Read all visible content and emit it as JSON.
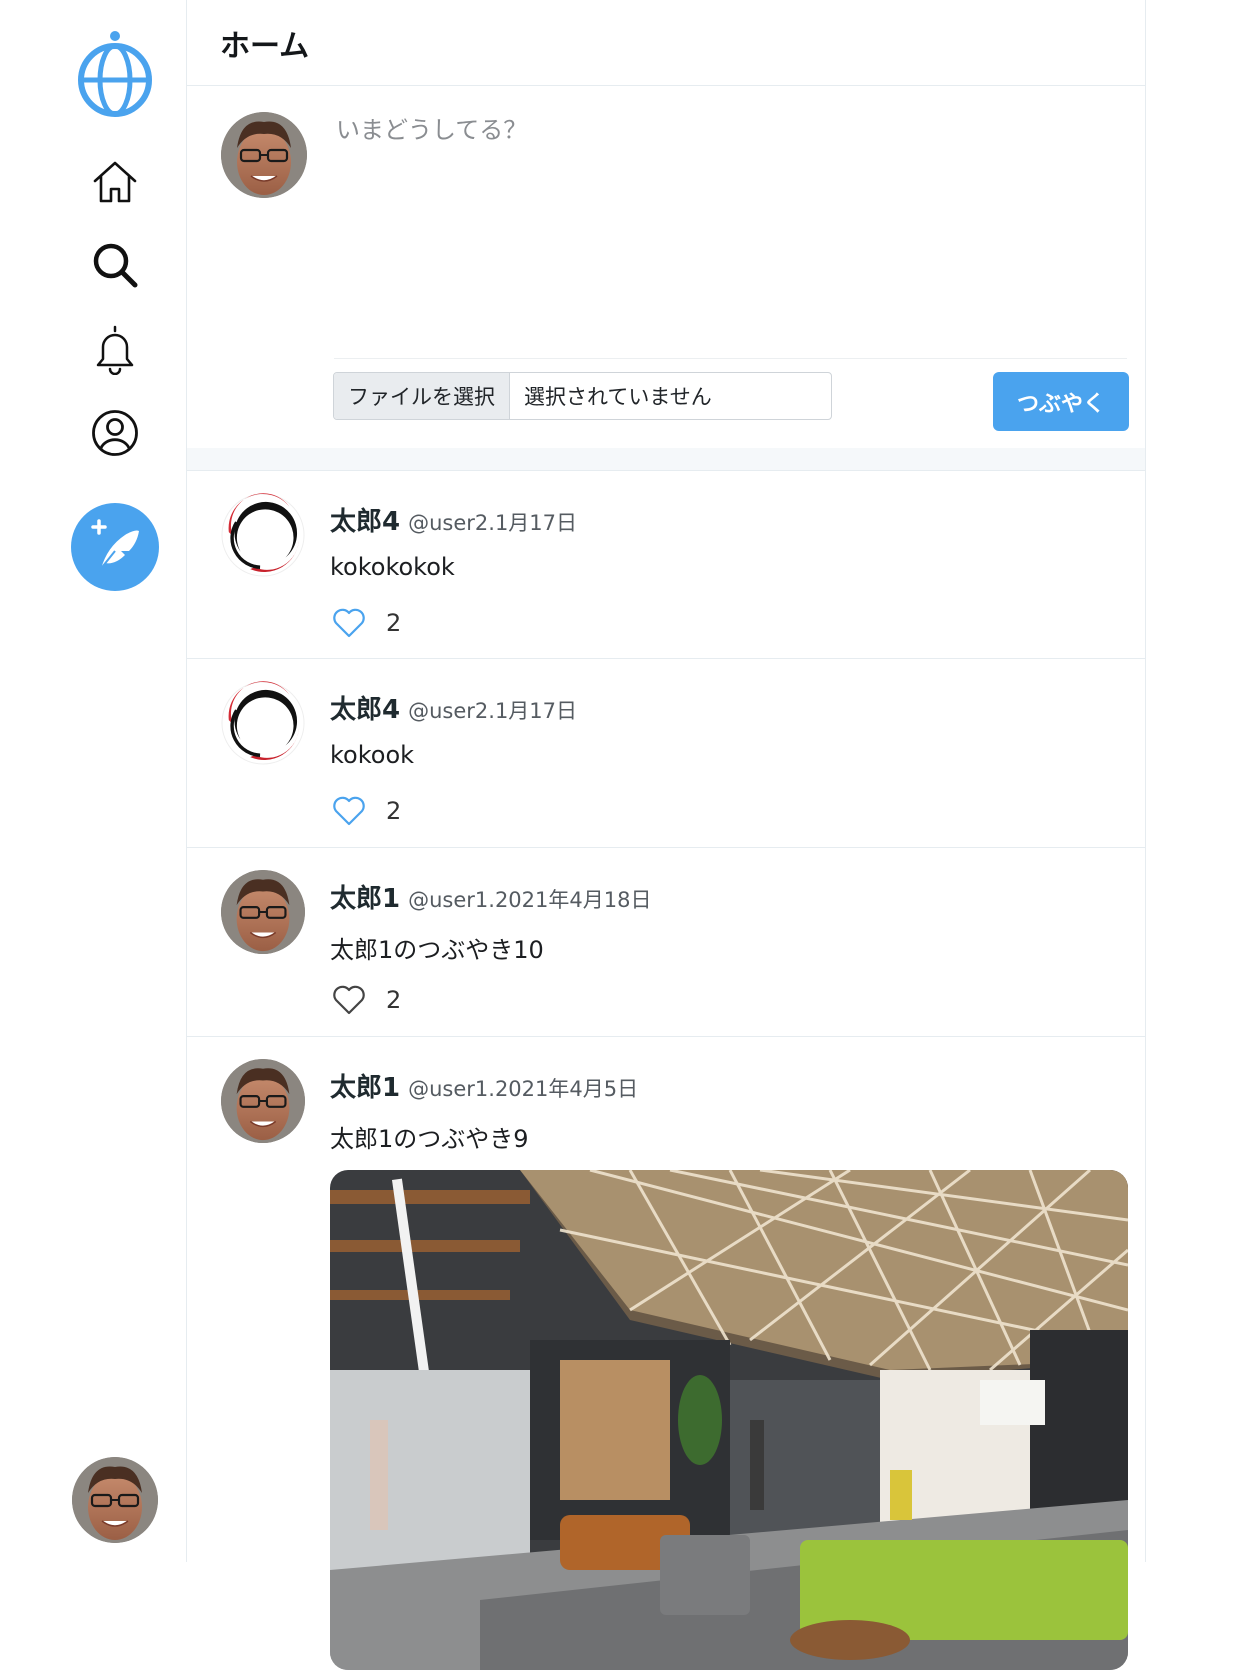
{
  "sidebar": {
    "icons": [
      "globe-logo-icon",
      "home-icon",
      "search-icon",
      "bell-icon",
      "user-circle-icon",
      "feather-plus-icon"
    ]
  },
  "header": {
    "title": "ホーム"
  },
  "composer": {
    "placeholder": "いまどうしてる？",
    "file_button_label": "ファイルを選択",
    "file_status": "選択されていません",
    "submit_label": "つぶやく"
  },
  "colors": {
    "accent": "#4aa3ee",
    "like_blue": "#4aa3ee",
    "like_gray": "#444444"
  },
  "posts": [
    {
      "name": "太郎4",
      "handle": "@user2",
      "date": ".1月17日",
      "text": "kokokokok",
      "likes": "2",
      "liked": true
    },
    {
      "name": "太郎4",
      "handle": "@user2",
      "date": ".1月17日",
      "text": "kokook",
      "likes": "2",
      "liked": true
    },
    {
      "name": "太郎1",
      "handle": "@user1",
      "date": ".2021年4月18日",
      "text": "太郎1のつぶやき10",
      "likes": "2",
      "liked": false
    },
    {
      "name": "太郎1",
      "handle": "@user1",
      "date": ".2021年4月5日",
      "text": "太郎1のつぶやき9",
      "has_image": true
    }
  ]
}
